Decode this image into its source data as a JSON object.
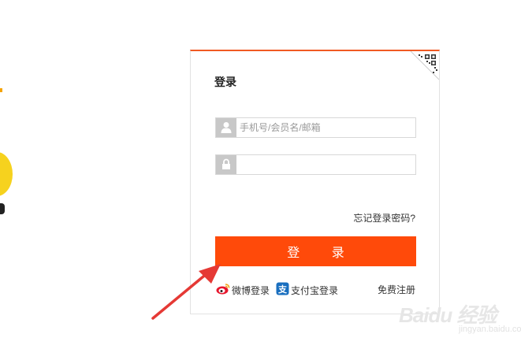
{
  "login": {
    "title": "登录",
    "username_placeholder": "手机号/会员名/邮箱",
    "password_placeholder": "",
    "forgot_password": "忘记登录密码?",
    "submit_label": "登 录",
    "weibo_login": "微博登录",
    "alipay_login": "支付宝登录",
    "register": "免费注册"
  },
  "watermark": {
    "text": "Baidu 经验",
    "sub": "jingyan.baidu.com"
  },
  "colors": {
    "accent": "#ff4a0a",
    "top_border": "#f05a23",
    "arrow": "#e53935"
  },
  "icons": [
    "qr-code-icon",
    "user-icon",
    "lock-icon",
    "weibo-icon",
    "alipay-icon",
    "arrow-pointer-icon"
  ]
}
